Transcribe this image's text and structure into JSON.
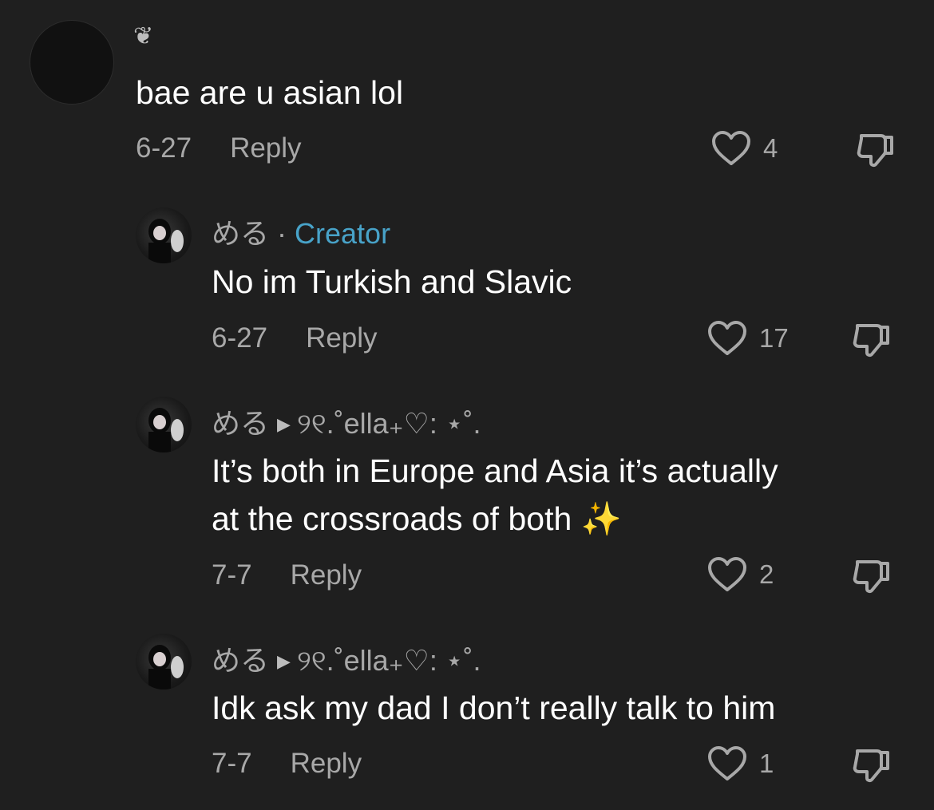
{
  "comments": [
    {
      "author": "",
      "author_badge": "❦",
      "text": "bae are u asian lol",
      "date": "6-27",
      "reply_label": "Reply",
      "likes": "4"
    },
    {
      "author": "める",
      "separator": " · ",
      "creator_label": "Creator",
      "text": "No im Turkish and Slavic",
      "date": "6-27",
      "reply_label": "Reply",
      "likes": "17"
    },
    {
      "author": "める",
      "reply_to": "୨୧.˚ella₊♡: ⋆˚.",
      "text_lines": [
        "It’s both in Europe and Asia it’s actually",
        "at the crossroads of both ✨"
      ],
      "date": "7-7",
      "reply_label": "Reply",
      "likes": "2"
    },
    {
      "author": "める",
      "reply_to": "୨୧.˚ella₊♡: ⋆˚.",
      "text": "Idk ask my dad I don’t really talk to him",
      "date": "7-7",
      "reply_label": "Reply",
      "likes": "1"
    }
  ],
  "icons": {
    "like": "heart-outline-icon",
    "dislike": "thumbs-down-icon",
    "reply_arrow": "triangle-right-icon"
  },
  "colors": {
    "background": "#1f1f1f",
    "creator": "#48a3c9",
    "secondary_text": "#a8a8a8"
  }
}
